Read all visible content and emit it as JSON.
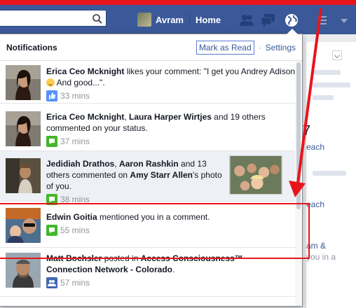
{
  "topbar": {
    "search_placeholder": "",
    "profile_name": "Avram",
    "home_label": "Home",
    "icons": [
      "friend-requests-icon",
      "messages-icon",
      "notifications-globe-icon",
      "quick-links-icon",
      "account-caret-icon"
    ]
  },
  "notifications": {
    "title": "Notifications",
    "mark_read_label": "Mark as Read",
    "settings_label": "Settings",
    "items": [
      {
        "actor": "Erica Ceo Mcknight",
        "rest": " likes your comment: \"I get you Andrey Adison ",
        "rest2": " And good...\".",
        "time": "33 mins",
        "meta_icon": "like-icon",
        "unread": false
      },
      {
        "actor": "Erica Ceo Mcknight",
        "sep": ", ",
        "actor2": "Laura Harper Wirtjes",
        "rest": " and 19 others commented on your status.",
        "time": "37 mins",
        "meta_icon": "comment-icon",
        "unread": false
      },
      {
        "actor": "Jedidiah Drathos",
        "sep": ", ",
        "actor2": "Aaron Rashkin",
        "rest": " and 13 others commented on ",
        "target": "Amy Starr Allen",
        "rest2": "'s photo of you.",
        "time": "38 mins",
        "meta_icon": "comment-icon",
        "unread": true
      },
      {
        "actor": "Edwin Goitia",
        "rest": " mentioned you in a comment.",
        "time": "55 mins",
        "meta_icon": "comment-icon",
        "unread": false
      },
      {
        "actor": "Matt Bochsler",
        "rest": " posted in ",
        "target": "Access Consciousness™ Connection Network - Colorado",
        "rest2": ".",
        "time": "57 mins",
        "meta_icon": "group-icon",
        "unread": false
      }
    ]
  },
  "background": {
    "number": "7",
    "link1": "each",
    "link2": "each",
    "link3": "am &",
    "text3": "you in a"
  },
  "colors": {
    "nav": "#3b5998",
    "annotation": "#e8141c",
    "unread_bg": "#edf0f5"
  }
}
